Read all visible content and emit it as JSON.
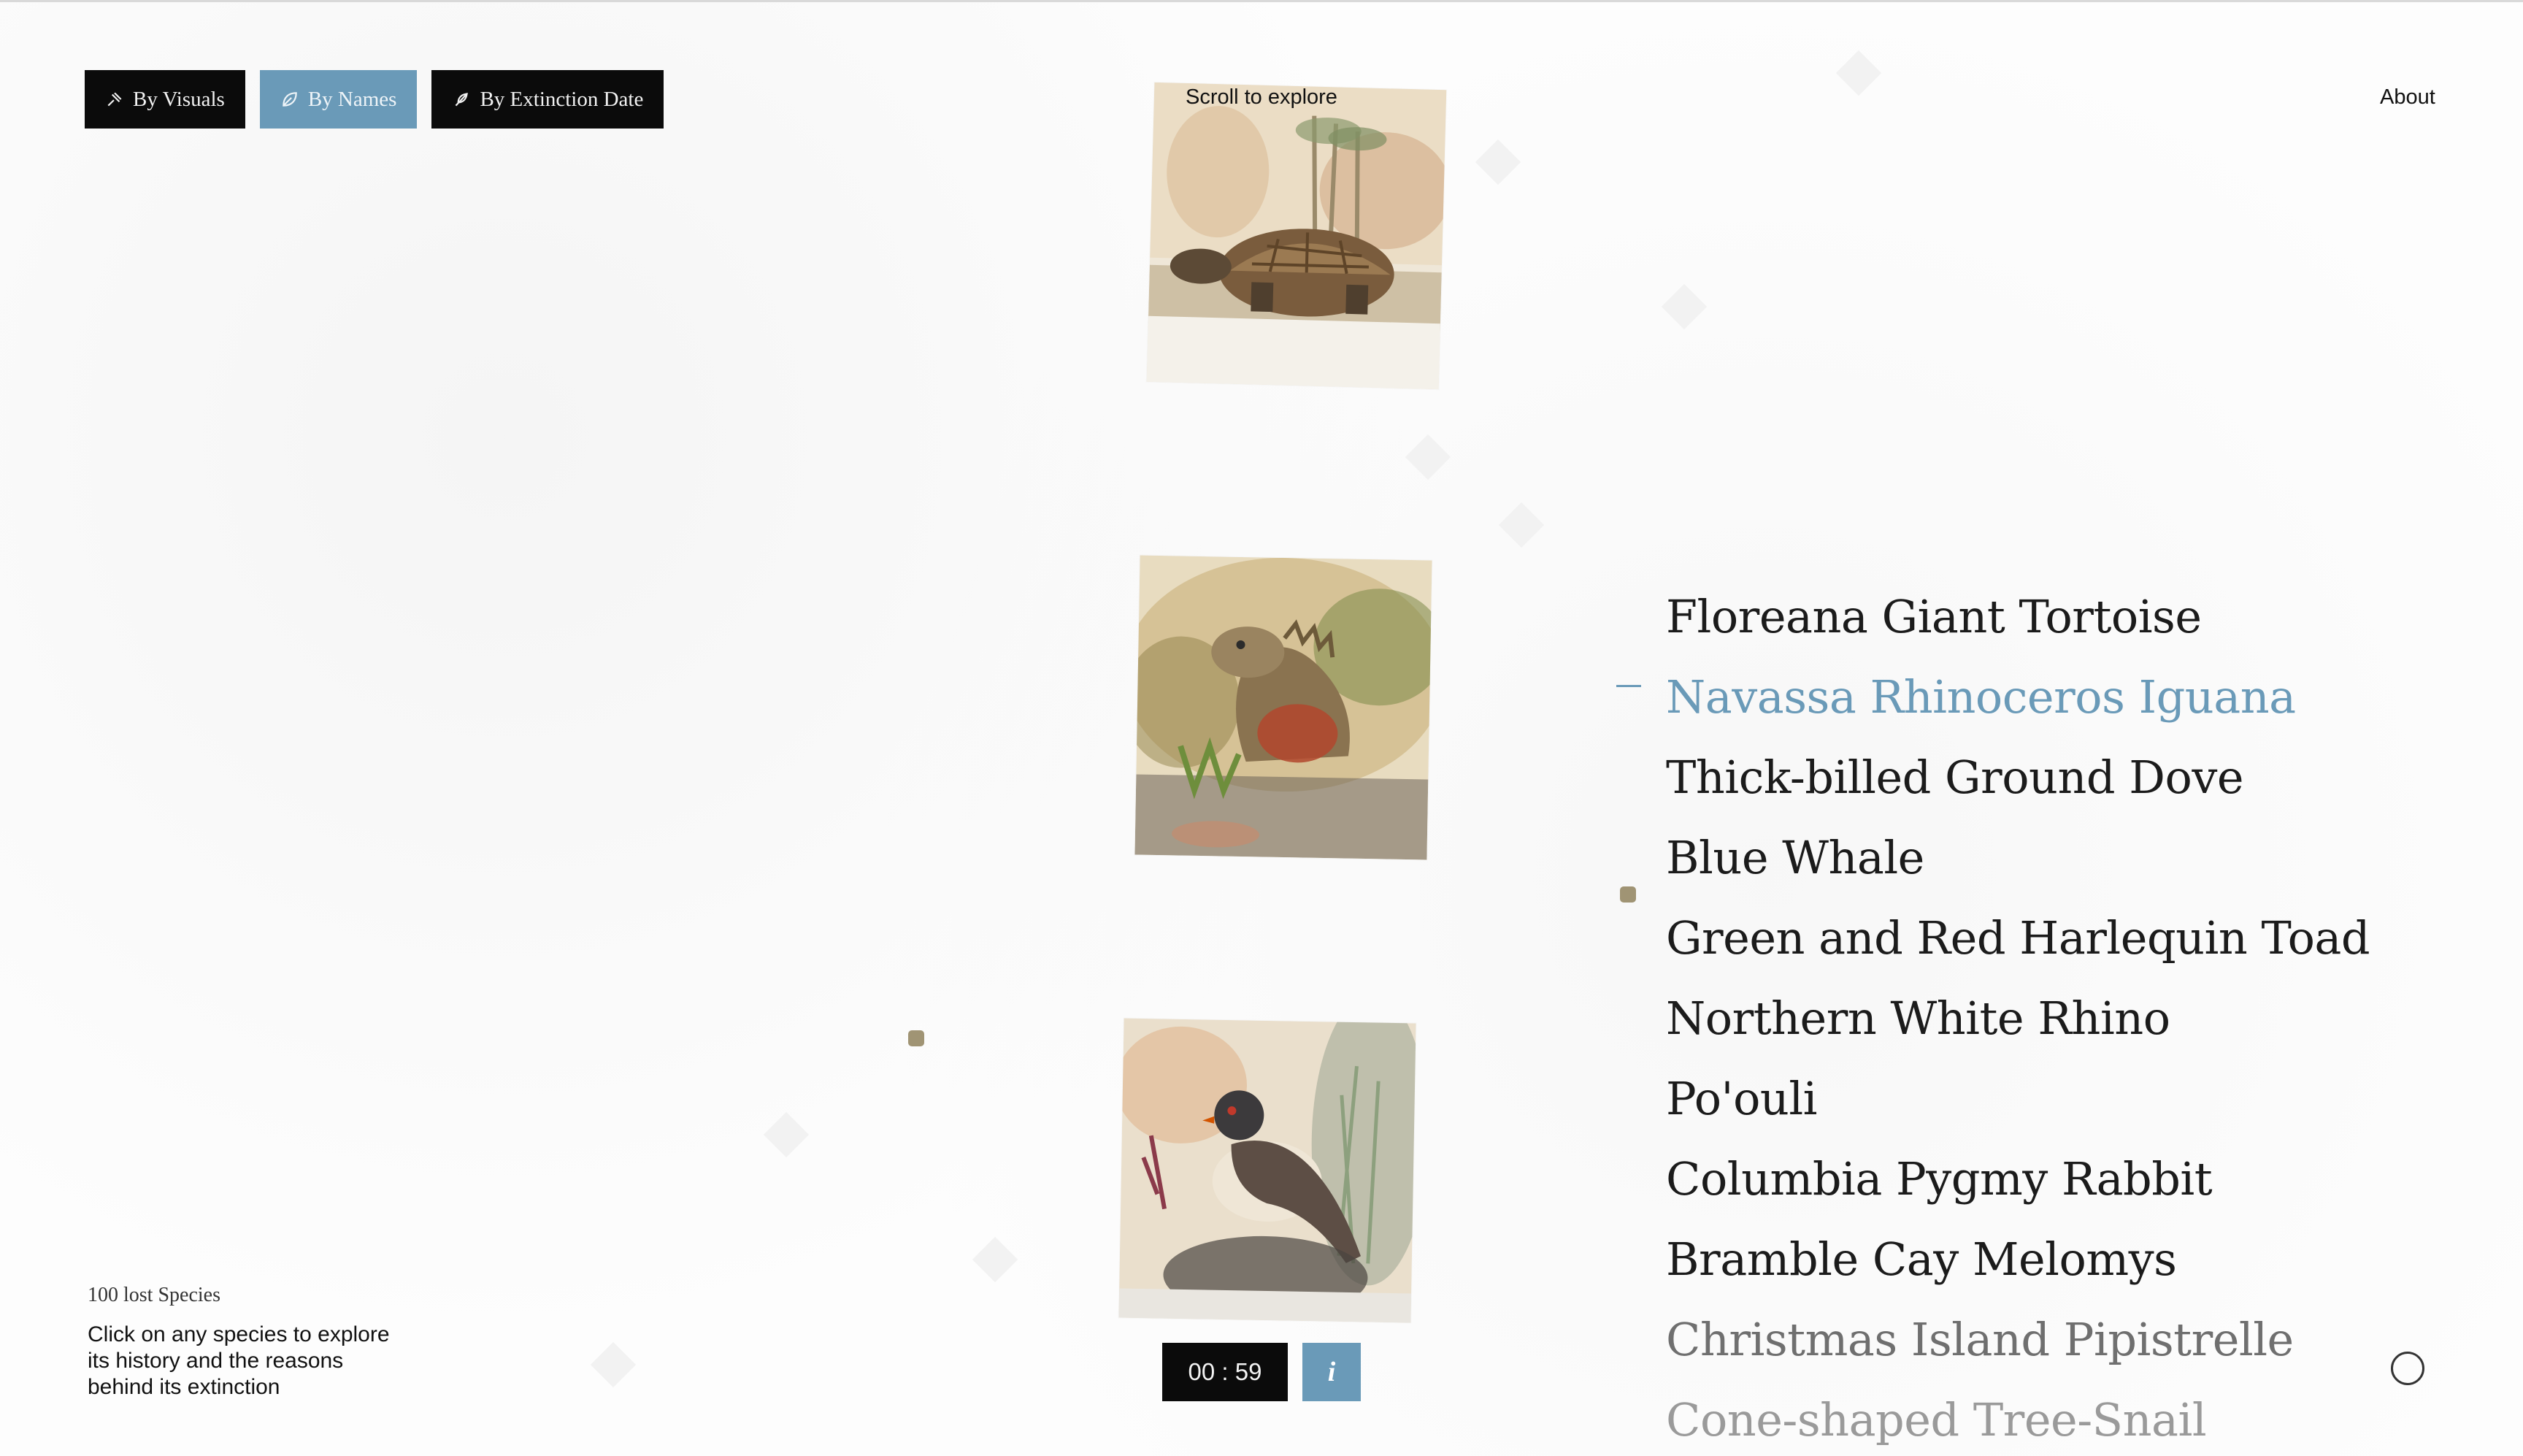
{
  "filters": [
    {
      "label": "By Visuals",
      "icon": "pin-icon",
      "active": false
    },
    {
      "label": "By Names",
      "icon": "leaf-icon",
      "active": true
    },
    {
      "label": "By Extinction Date",
      "icon": "feather-icon",
      "active": false
    }
  ],
  "header": {
    "scroll_hint": "Scroll to explore",
    "about": "About"
  },
  "species": [
    "Floreana Giant Tortoise",
    "Navassa Rhinoceros Iguana",
    "Thick-billed Ground Dove",
    "Blue Whale",
    "Green and Red Harlequin Toad",
    "Northern White Rhino",
    "Po'ouli",
    "Columbia Pygmy Rabbit",
    "Bramble Cay Melomys",
    "Christmas Island Pipistrelle",
    "Cone-shaped Tree-Snail"
  ],
  "active_species_index": 1,
  "images": [
    {
      "subject": "tortoise"
    },
    {
      "subject": "iguana"
    },
    {
      "subject": "ground-dove"
    }
  ],
  "footer": {
    "count_label": "100 lost Species",
    "help_text": "Click on any species to explore its history and the reasons behind its extinction"
  },
  "timer": "00 : 59",
  "info_label": "i",
  "colors": {
    "accent": "#6a9ab8",
    "dark": "#0b0b0b"
  }
}
